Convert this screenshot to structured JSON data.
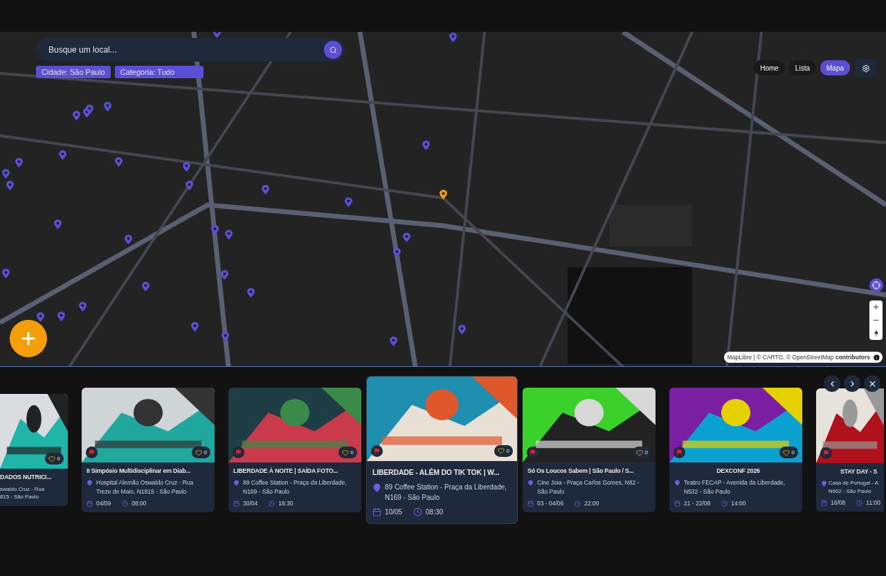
{
  "search": {
    "placeholder": "Busque um local..."
  },
  "filters": [
    {
      "label": "Cidade: São Paulo"
    },
    {
      "label": "Categoria:  Tudo"
    }
  ],
  "nav": [
    {
      "label": "Home",
      "selected": false
    },
    {
      "label": "Lista",
      "selected": false
    },
    {
      "label": "Mapa",
      "selected": true
    }
  ],
  "map": {
    "attribution": "MapLibre | © CARTO, © OpenStreetMap **contributors**",
    "markers": [
      {
        "selected": false
      },
      {
        "selected": false
      },
      {
        "selected": false
      },
      {
        "selected": false
      },
      {
        "selected": false
      },
      {
        "selected": false
      },
      {
        "selected": false
      },
      {
        "selected": false
      },
      {
        "selected": false
      },
      {
        "selected": false
      },
      {
        "selected": false
      },
      {
        "selected": false
      },
      {
        "selected": false
      },
      {
        "selected": false
      },
      {
        "selected": false
      },
      {
        "selected": false
      },
      {
        "selected": true
      },
      {
        "selected": false
      },
      {
        "selected": false
      },
      {
        "selected": false
      },
      {
        "selected": false
      },
      {
        "selected": false
      },
      {
        "selected": false
      },
      {
        "selected": false
      },
      {
        "selected": false
      },
      {
        "selected": false
      },
      {
        "selected": false
      },
      {
        "selected": false
      },
      {
        "selected": false
      },
      {
        "selected": false
      },
      {
        "selected": false
      },
      {
        "selected": false
      },
      {
        "selected": false
      },
      {
        "selected": false
      }
    ]
  },
  "events": [
    {
      "kind": "cut-left",
      "title": "DADOS NUTRICI...",
      "address_lines": [
        "swaldo Cruz - Rua",
        "815 - São Paulo"
      ],
      "likes": "0"
    },
    {
      "kind": "regular",
      "title": "II Simpósio Multidisciplinar em Diab...",
      "address_lines": [
        "Hospital Alemão Oswaldo Cruz - Rua",
        "Treze de Maio, N1815 - São Paulo"
      ],
      "date": "04/09",
      "time": "08:00",
      "likes": "0"
    },
    {
      "kind": "regular",
      "title": "LIBERDADE À NOITE | SAÍDA FOTO...",
      "address_lines": [
        "89 Coffee Station - Praça da Liberdade,",
        "N169 - São Paulo"
      ],
      "date": "30/04",
      "time": "18:30",
      "likes": "0"
    },
    {
      "kind": "featured",
      "title": "LIBERDADE - ALÉM DO TIK TOK | W...",
      "address_lines": [
        "89 Coffee Station - Praça da Liberdade,",
        "N169 - São Paulo"
      ],
      "date": "10/05",
      "time": "08:30",
      "likes": "0"
    },
    {
      "kind": "regular",
      "title": "Só Os Loucos Sabem | São Paulo / S...",
      "address_lines": [
        "Cine Joia - Praça Carlos Gomes, N82 -",
        "São Paulo"
      ],
      "date": "03 - 04/06",
      "time": "22:00",
      "likes": "0"
    },
    {
      "kind": "regular",
      "title": "DEXCONF 2026",
      "address_lines": [
        "Teatro FECAP - Avenida da Liberdade,",
        "N532 - São Paulo"
      ],
      "date": "21 - 22/08",
      "time": "14:00",
      "likes": "0"
    },
    {
      "kind": "cut-right",
      "title": "STAY DAY - S",
      "address_lines": [
        "Casa de Portugal - A",
        "N602 - São Paulo"
      ],
      "date": "16/08",
      "time": "11:00"
    }
  ]
}
